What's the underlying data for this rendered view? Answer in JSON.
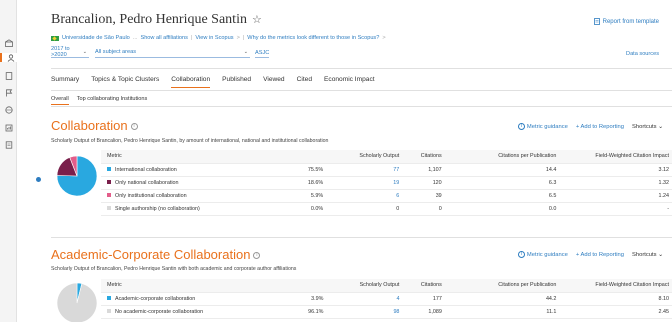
{
  "colors": {
    "accent": "#e9711c",
    "link": "#2e7dc0",
    "international": "#29a8e0",
    "national": "#7a1f4b",
    "institutional": "#e35d8a",
    "single": "#d9d9d9",
    "academic_corporate": "#29a8e0",
    "no_academic_corporate": "#d9d9d9"
  },
  "sidebar": {
    "icons": [
      "institution-icon",
      "person-icon",
      "document-icon",
      "flag-icon",
      "globe-icon",
      "report-icon",
      "export-icon"
    ],
    "active_index": 1
  },
  "header": {
    "title": "Brancalion, Pedro Henrique Santin",
    "star": "☆",
    "report_link": "Report from template",
    "affiliation": "Universidade de São Paulo",
    "affiliation_links": [
      "Show all affiliations",
      "View in Scopus",
      "Why do the metrics look different to those in Scopus?"
    ],
    "year_range": "2017 to >2020",
    "subject_areas": "All subject areas",
    "asjc": "ASJC",
    "data_sources": "Data sources"
  },
  "tabs": [
    {
      "label": "Summary",
      "active": false
    },
    {
      "label": "Topics & Topic Clusters",
      "active": false
    },
    {
      "label": "Collaboration",
      "active": true
    },
    {
      "label": "Published",
      "active": false
    },
    {
      "label": "Viewed",
      "active": false
    },
    {
      "label": "Cited",
      "active": false
    },
    {
      "label": "Economic Impact",
      "active": false
    }
  ],
  "subtabs": [
    {
      "label": "Overall",
      "active": true
    },
    {
      "label": "Top collaborating Institutions",
      "active": false
    }
  ],
  "collaboration": {
    "title": "Collaboration",
    "info": "i",
    "description": "Scholarly Output of Brancalion, Pedro Henrique Santin, by amount of international, national and institutional collaboration",
    "actions": {
      "metric_guidance": "Metric guidance",
      "add_to_reporting": "+ Add to Reporting",
      "shortcuts": "Shortcuts"
    },
    "columns": [
      "Metric",
      "Scholarly Output",
      "Citations",
      "Citations per Publication",
      "Field-Weighted Citation Impact"
    ],
    "rows": [
      {
        "metric": "International collaboration",
        "pct": "75.5%",
        "output": "77",
        "citations": "1,107",
        "cpp": "14.4",
        "fwci": "3.12",
        "share": 75.5,
        "color_key": "international"
      },
      {
        "metric": "Only national collaboration",
        "pct": "18.6%",
        "output": "19",
        "citations": "120",
        "cpp": "6.3",
        "fwci": "1.32",
        "share": 18.6,
        "color_key": "national"
      },
      {
        "metric": "Only institutional collaboration",
        "pct": "5.9%",
        "output": "6",
        "citations": "39",
        "cpp": "6.5",
        "fwci": "1.24",
        "share": 5.9,
        "color_key": "institutional"
      },
      {
        "metric": "Single authorship (no collaboration)",
        "pct": "0.0%",
        "output": "0",
        "citations": "0",
        "cpp": "0.0",
        "fwci": "-",
        "share": 0,
        "color_key": "single"
      }
    ]
  },
  "academic_corporate": {
    "title": "Academic-Corporate Collaboration",
    "info": "i",
    "description": "Scholarly Output of Brancalion, Pedro Henrique Santin with both academic and corporate author affiliations",
    "actions": {
      "metric_guidance": "Metric guidance",
      "add_to_reporting": "+ Add to Reporting",
      "shortcuts": "Shortcuts"
    },
    "columns": [
      "Metric",
      "Scholarly Output",
      "Citations",
      "Citations per Publication",
      "Field-Weighted Citation Impact"
    ],
    "rows": [
      {
        "metric": "Academic-corporate collaboration",
        "pct": "3.9%",
        "output": "4",
        "citations": "177",
        "cpp": "44.2",
        "fwci": "8.10",
        "share": 3.9,
        "color_key": "academic_corporate"
      },
      {
        "metric": "No academic-corporate collaboration",
        "pct": "96.1%",
        "output": "98",
        "citations": "1,089",
        "cpp": "11.1",
        "fwci": "2.45",
        "share": 96.1,
        "color_key": "no_academic_corporate"
      }
    ]
  }
}
